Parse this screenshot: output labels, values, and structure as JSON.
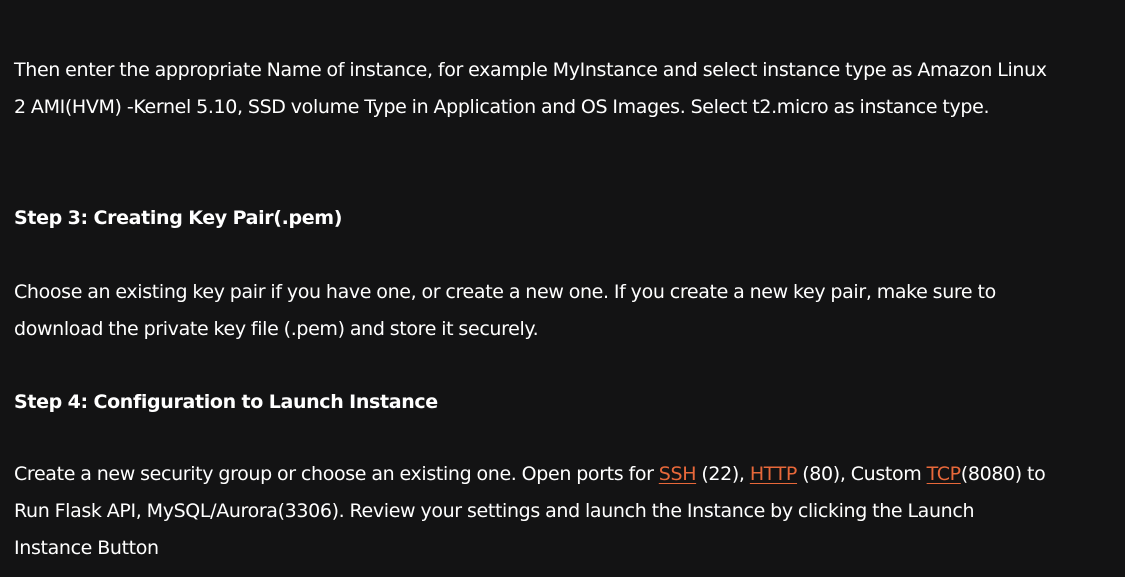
{
  "paragraph_1": "Then enter the appropriate Name of instance, for example MyInstance and select instance type as Amazon Linux 2 AMI(HVM) -Kernel 5.10, SSD volume Type in Application and OS Images. Select t2.micro as instance type.",
  "step3": {
    "heading": "Step 3: Creating Key Pair(.pem)",
    "body": "Choose an existing key pair if you have one, or create a new one. If you create a new key pair, make sure to download the private key file (.pem) and store it securely."
  },
  "step4": {
    "heading": "Step 4: Configuration to Launch Instance",
    "body_part1": "Create a new security group or choose an existing one. Open ports for ",
    "link_ssh": "SSH",
    "body_part2": " (22), ",
    "link_http": "HTTP",
    "body_part3": " (80), Custom ",
    "link_tcp": "TCP",
    "body_part4": "(8080) to Run Flask API, MySQL/Aurora(3306). Review your settings and launch the Instance by clicking the Launch Instance Button"
  },
  "colors": {
    "background": "#131314",
    "text": "#ffffff",
    "link": "#e8683a"
  }
}
